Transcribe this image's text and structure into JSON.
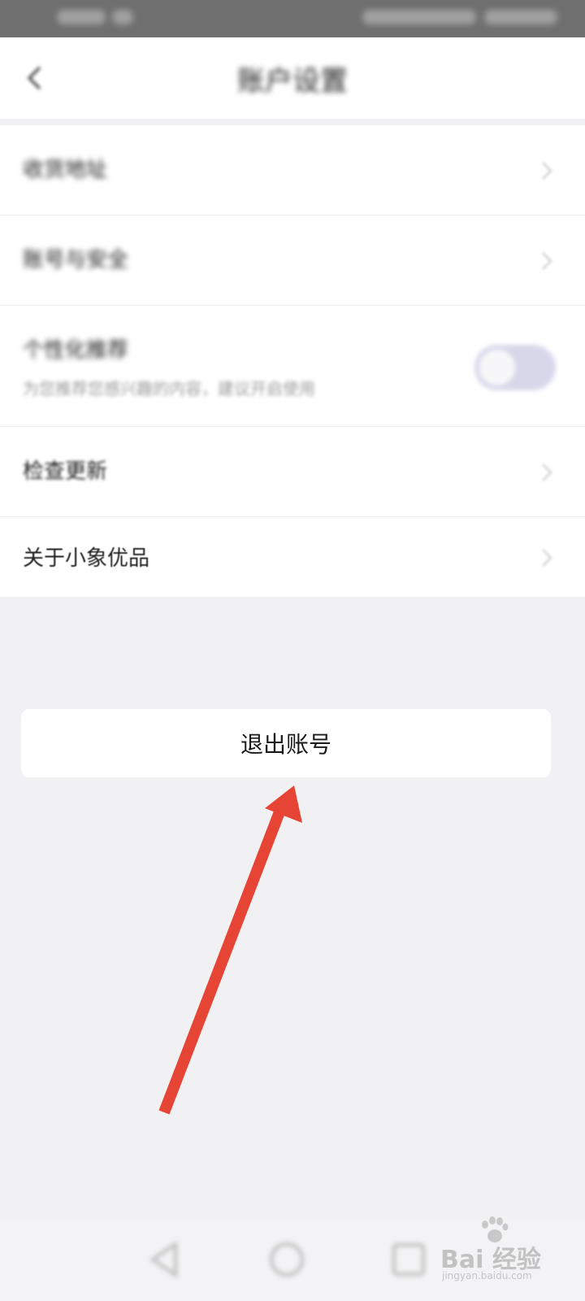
{
  "status_bar": {},
  "header": {
    "title": "账户设置"
  },
  "settings": [
    {
      "label": "收货地址",
      "type": "link"
    },
    {
      "label": "账号与安全",
      "type": "link"
    },
    {
      "label": "个性化推荐",
      "subtitle": "为您推荐您感兴趣的内容，建议开启使用",
      "type": "toggle",
      "toggle_on": false
    },
    {
      "label": "检查更新",
      "type": "link"
    },
    {
      "label": "关于小象优品",
      "type": "link"
    }
  ],
  "logout": {
    "label": "退出账号"
  },
  "annotation": {
    "arrow_color": "#e64536"
  },
  "watermark": {
    "logo_text": "Bai 经验",
    "site": "jingyan.baidu.com"
  },
  "colors": {
    "page_background": "#f1f1f3",
    "status_bar": "#6f6f6f",
    "card": "#ffffff",
    "toggle_track": "#d7d7ea"
  }
}
